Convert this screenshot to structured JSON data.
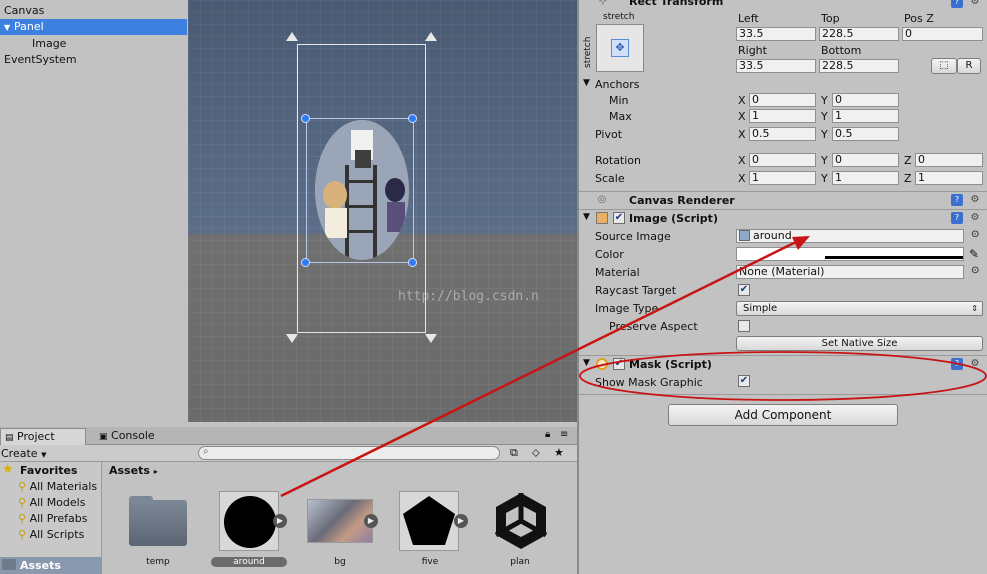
{
  "hierarchy": {
    "items": [
      {
        "label": "Canvas"
      },
      {
        "label": "Panel"
      },
      {
        "label": "Image"
      },
      {
        "label": "EventSystem"
      }
    ]
  },
  "scene": {
    "watermark": "http://blog.csdn.n"
  },
  "inspector": {
    "rect_transform": {
      "title": "Rect Transform",
      "anchor_preset": "stretch",
      "anchor_preset_side": "stretch",
      "left_label": "Left",
      "left_value": "33.5",
      "top_label": "Top",
      "top_value": "228.5",
      "posz_label": "Pos Z",
      "posz_value": "0",
      "right_label": "Right",
      "right_value": "33.5",
      "bottom_label": "Bottom",
      "bottom_value": "228.5",
      "r_button": "R",
      "anchors_label": "Anchors",
      "min_label": "Min",
      "min_x": "0",
      "min_y": "0",
      "max_label": "Max",
      "max_x": "1",
      "max_y": "1",
      "pivot_label": "Pivot",
      "pivot_x": "0.5",
      "pivot_y": "0.5",
      "rotation_label": "Rotation",
      "rot_x": "0",
      "rot_y": "0",
      "rot_z": "0",
      "scale_label": "Scale",
      "scale_x": "1",
      "scale_y": "1",
      "scale_z": "1",
      "x_label": "X",
      "y_label": "Y",
      "z_label": "Z"
    },
    "canvas_renderer": {
      "title": "Canvas Renderer"
    },
    "image_script": {
      "title": "Image (Script)",
      "source_image_label": "Source Image",
      "source_image_value": "around",
      "color_label": "Color",
      "material_label": "Material",
      "material_value": "None (Material)",
      "raycast_label": "Raycast Target",
      "image_type_label": "Image Type",
      "image_type_value": "Simple",
      "preserve_label": "Preserve Aspect",
      "native_size_button": "Set Native Size"
    },
    "mask_script": {
      "title": "Mask (Script)",
      "show_mask_label": "Show Mask Graphic"
    },
    "add_component": "Add Component"
  },
  "project": {
    "tabs": [
      {
        "label": "Project"
      },
      {
        "label": "Console"
      }
    ],
    "create_label": "Create",
    "favorites_label": "Favorites",
    "favorites": [
      {
        "label": "All Materials"
      },
      {
        "label": "All Models"
      },
      {
        "label": "All Prefabs"
      },
      {
        "label": "All Scripts"
      }
    ],
    "assets_label": "Assets",
    "breadcrumb": "Assets",
    "assets": [
      {
        "label": "temp"
      },
      {
        "label": "around"
      },
      {
        "label": "bg"
      },
      {
        "label": "five"
      },
      {
        "label": "plan"
      }
    ]
  },
  "colors": {
    "selection": "#3d80df",
    "annotation_red": "#c81414"
  }
}
